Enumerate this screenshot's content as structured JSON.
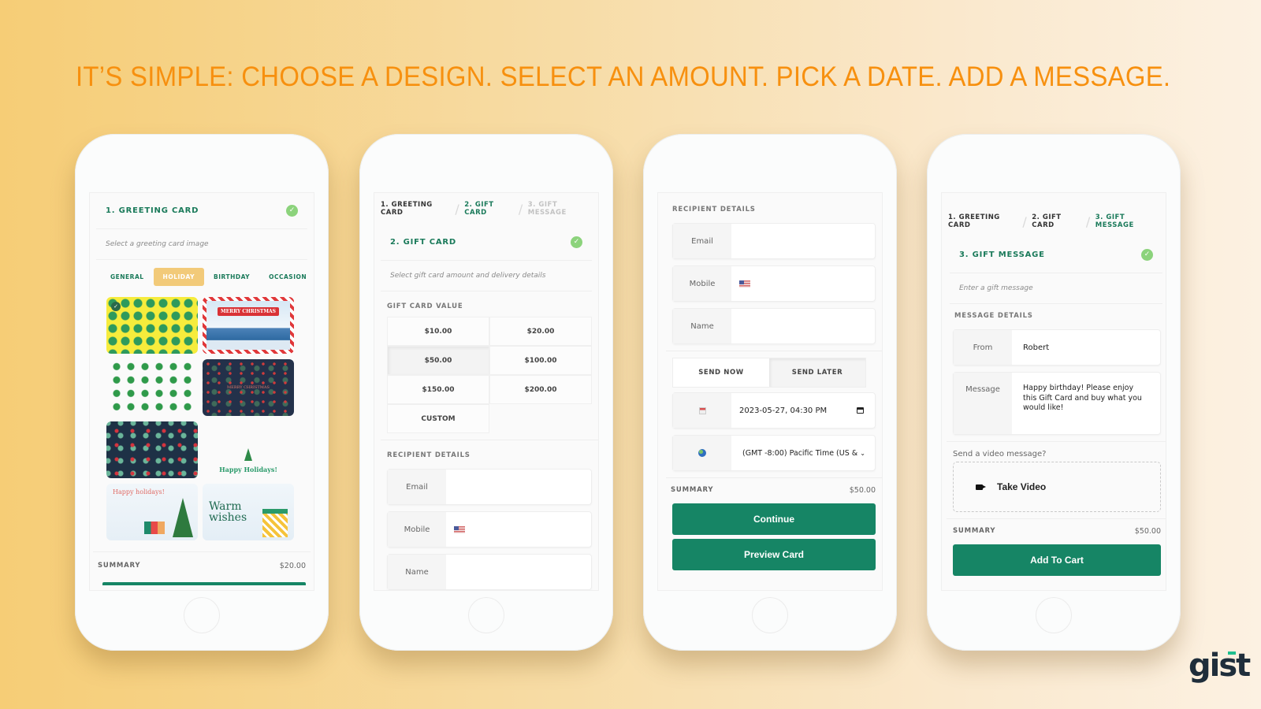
{
  "headline": "IT’S SIMPLE: CHOOSE A DESIGN. SELECT AN AMOUNT. PICK A DATE. ADD A MESSAGE.",
  "brand": {
    "logo_text": "gist",
    "accent": "#1fbf8f",
    "primary_green": "#168565",
    "headline_color": "#f7900f"
  },
  "phone1": {
    "section_title": "1. GREETING CARD",
    "hint": "Select a greeting card image",
    "tabs": [
      {
        "label": "GENERAL",
        "active": false
      },
      {
        "label": "HOLIDAY",
        "active": true
      },
      {
        "label": "BIRTHDAY",
        "active": false
      },
      {
        "label": "OCCASION",
        "active": false
      }
    ],
    "cards": [
      {
        "name": "yellow-trees",
        "text": "",
        "selected": true
      },
      {
        "name": "merry-christmas-candy",
        "text": "MERRY CHRISTMAS"
      },
      {
        "name": "tree-grid",
        "text": ""
      },
      {
        "name": "holly-navy",
        "text": "MERRY CHRISTMAS"
      },
      {
        "name": "navy-pattern",
        "text": ""
      },
      {
        "name": "happy-holidays-lights",
        "text": "Happy Holidays!"
      },
      {
        "name": "happy-holidays-bear",
        "text": "Happy holidays!"
      },
      {
        "name": "warm-wishes",
        "text": "Warm wishes"
      }
    ],
    "summary_label": "SUMMARY",
    "summary_value": "$20.00"
  },
  "phone2": {
    "breadcrumb": [
      "1. GREETING CARD",
      "2. GIFT CARD",
      "3. GIFT MESSAGE"
    ],
    "section_title": "2. GIFT CARD",
    "hint": "Select gift card amount and delivery details",
    "value_label": "GIFT CARD VALUE",
    "amounts": [
      "$10.00",
      "$20.00",
      "$50.00",
      "$100.00",
      "$150.00",
      "$200.00",
      "CUSTOM"
    ],
    "selected_amount": "$50.00",
    "recipient_label": "RECIPIENT DETAILS",
    "fields": {
      "email": "Email",
      "mobile": "Mobile",
      "name": "Name"
    }
  },
  "phone3": {
    "recipient_label": "RECIPIENT DETAILS",
    "fields": {
      "email": "Email",
      "mobile": "Mobile",
      "name": "Name"
    },
    "send_now": "SEND NOW",
    "send_later": "SEND LATER",
    "selected_send": "SEND LATER",
    "datetime_value": "2023-05-27, 04:30 PM",
    "timezone_value": "(GMT -8:00) Pacific Time (US &",
    "summary_label": "SUMMARY",
    "summary_value": "$50.00",
    "continue_label": "Continue",
    "preview_label": "Preview Card"
  },
  "phone4": {
    "breadcrumb": [
      "1. GREETING CARD",
      "2. GIFT CARD",
      "3. GIFT MESSAGE"
    ],
    "section_title": "3. GIFT MESSAGE",
    "hint": "Enter a gift message",
    "details_label": "MESSAGE DETAILS",
    "from_label": "From",
    "from_value": "Robert",
    "message_label": "Message",
    "message_value": "Happy birthday! Please enjoy this Gift Card and buy what you would like!",
    "video_prompt": "Send a video message?",
    "video_button": "Take Video",
    "summary_label": "SUMMARY",
    "summary_value": "$50.00",
    "add_to_cart_label": "Add To Cart"
  }
}
